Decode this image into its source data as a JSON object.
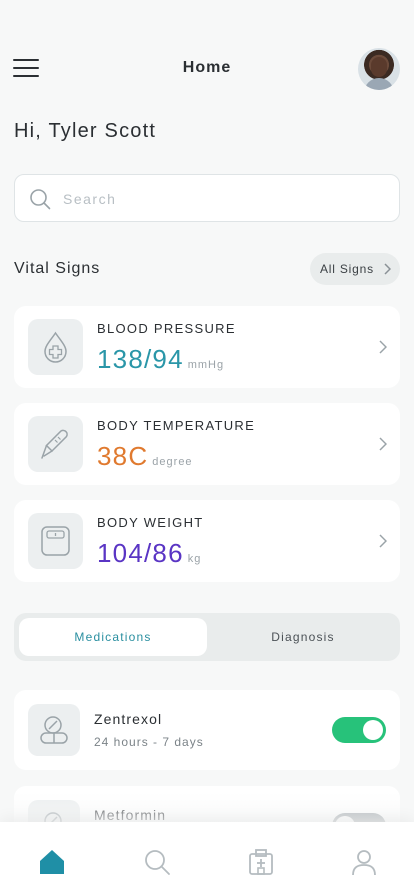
{
  "header": {
    "title": "Home",
    "menu_icon": "hamburger-menu-icon",
    "avatar": "user-avatar"
  },
  "greeting": "Hi, Tyler Scott",
  "search": {
    "placeholder": "Search",
    "value": "",
    "icon": "search-icon"
  },
  "vital_signs": {
    "title": "Vital Signs",
    "all_label": "All Signs",
    "items": [
      {
        "label": "BLOOD PRESSURE",
        "value": "138/94",
        "unit": "mmHg",
        "color": "#2a96a8",
        "icon": "blood-drop-icon"
      },
      {
        "label": "BODY TEMPERATURE",
        "value": "38C",
        "unit": "degree",
        "color": "#e07a2f",
        "icon": "thermometer-icon"
      },
      {
        "label": "BODY WEIGHT",
        "value": "104/86",
        "unit": "kg",
        "color": "#5a35c4",
        "icon": "scale-icon"
      }
    ]
  },
  "tabs": {
    "active": "Medications",
    "inactive": "Diagnosis"
  },
  "medications": [
    {
      "name": "Zentrexol",
      "schedule": "24 hours - 7 days",
      "enabled": true,
      "icon": "pill-icon"
    },
    {
      "name": "Metformin",
      "schedule": "",
      "enabled": false,
      "icon": "pill-icon"
    }
  ],
  "bottom_nav": {
    "items": [
      "home-icon",
      "search-icon",
      "hospital-icon",
      "profile-icon"
    ],
    "active": "home-icon"
  },
  "colors": {
    "accent": "#1f8fa6",
    "toggle_on": "#27c27a",
    "toggle_off": "#9ea5aa"
  }
}
